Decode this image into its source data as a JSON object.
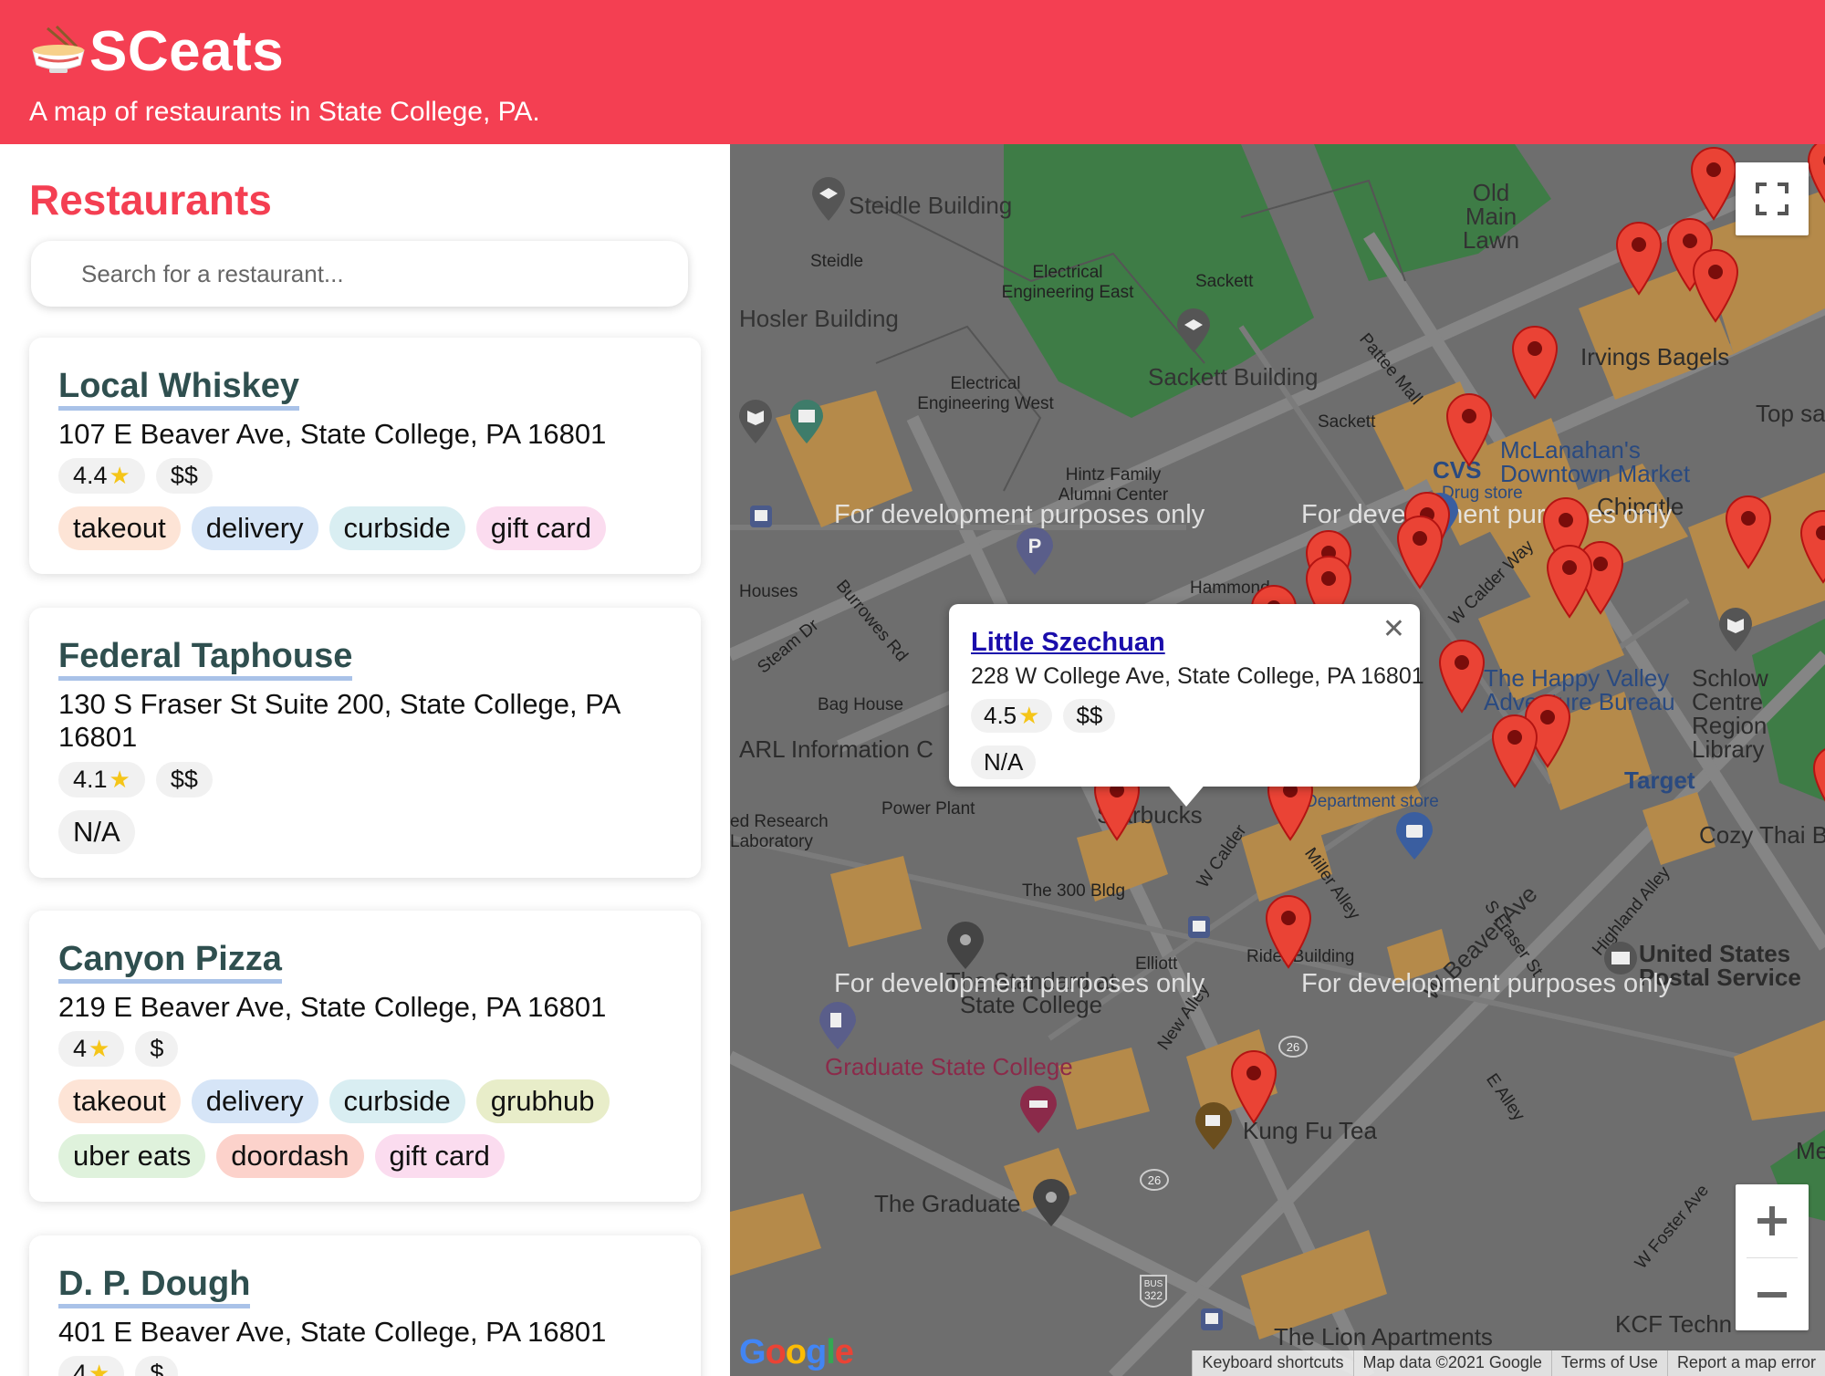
{
  "header": {
    "title": "SCeats",
    "tagline": "A map of restaurants in State College, PA."
  },
  "sidebar": {
    "title": "Restaurants",
    "search_placeholder": "Search for a restaurant..."
  },
  "restaurants": [
    {
      "name": "Local Whiskey",
      "address": "107 E Beaver Ave, State College, PA 16801",
      "rating": "4.4",
      "price": "$$",
      "tags": [
        "takeout",
        "delivery",
        "curbside",
        "gift card"
      ]
    },
    {
      "name": "Federal Taphouse",
      "address": "130 S Fraser St Suite 200, State College, PA 16801",
      "rating": "4.1",
      "price": "$$",
      "tags": [
        "N/A"
      ]
    },
    {
      "name": "Canyon Pizza",
      "address": "219 E Beaver Ave, State College, PA 16801",
      "rating": "4",
      "price": "$",
      "tags": [
        "takeout",
        "delivery",
        "curbside",
        "grubhub",
        "uber eats",
        "doordash",
        "gift card"
      ]
    },
    {
      "name": "D. P. Dough",
      "address": "401 E Beaver Ave, State College, PA 16801",
      "rating": "4",
      "price": "$",
      "tags": []
    }
  ],
  "popup": {
    "name": "Little Szechuan",
    "address": "228 W College Ave, State College, PA 16801",
    "rating": "4.5",
    "price": "$$",
    "tag": "N/A"
  },
  "map": {
    "watermark": "For development purposes only",
    "footer": [
      "Keyboard shortcuts",
      "Map data ©2021 Google",
      "Terms of Use",
      "Report a map error"
    ],
    "google_logo": "Google",
    "labels": [
      "Steidle Building",
      "Steidle",
      "Electrical Engineering East",
      "Sackett",
      "Old Main Lawn",
      "Hosler Building",
      "Sackett Building",
      "Electrical Engineering West",
      "Irvings Bagels",
      "Pattee Mall",
      "Sackett",
      "McLanahan's Downtown Market",
      "CVS",
      "Drug store",
      "Top sa",
      "Hintz Family Alumni Center",
      "Chipotle",
      "Houses",
      "Hammond",
      "Burrowes Rd",
      "Steam Dr",
      "W Calder Way",
      "Bag House",
      "The Happy Valley Adventure Bureau",
      "Schlow Centre Region Library",
      "ARL Information C",
      "Target",
      "Department store",
      "Power Plant",
      "ed Research Laboratory",
      "Starbucks",
      "W Calder",
      "W Beaver Ave",
      "Miller Alley",
      "Cozy Thai B",
      "The 300 Bldg",
      "S Fraser St",
      "Highland Alley",
      "Elliott",
      "Rider Building",
      "United States Postal Service",
      "The Standard at State College",
      "New Alley",
      "Graduate State College",
      "Kung Fu Tea",
      "E Alley",
      "The Graduate",
      "W Foster Ave",
      "The Lion Apartments",
      "KCF Techn",
      "Me"
    ]
  },
  "colors": {
    "brand": "#f43f52",
    "name_underline": "#a9c2e8",
    "card_name": "#2f4f4f",
    "pin": "#ea4335"
  }
}
